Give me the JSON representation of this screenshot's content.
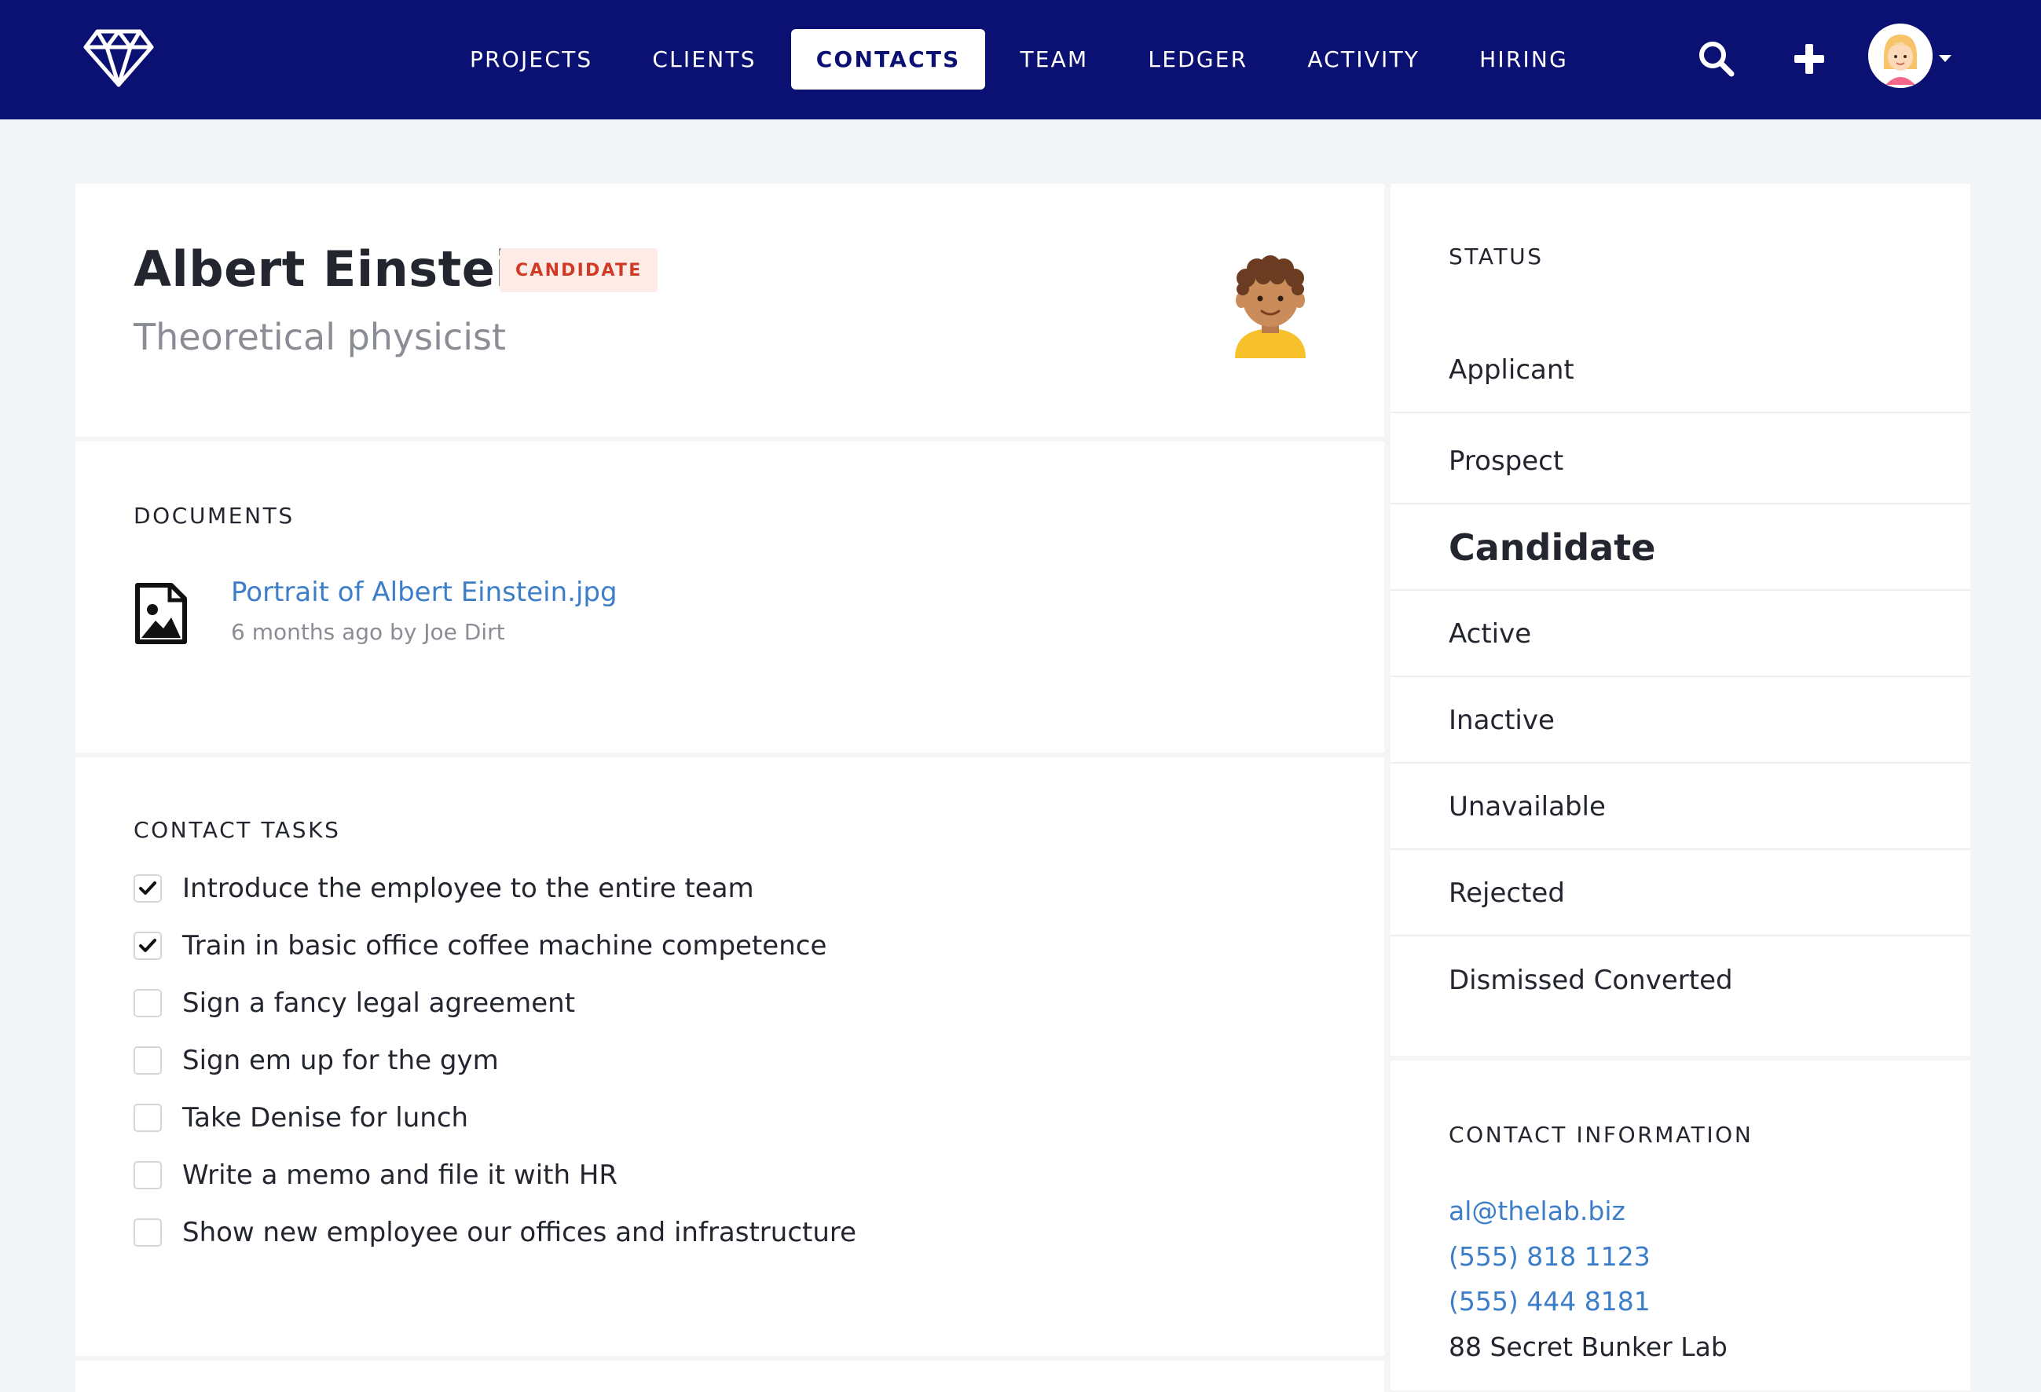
{
  "nav": {
    "items": [
      "PROJECTS",
      "CLIENTS",
      "CONTACTS",
      "TEAM",
      "LEDGER",
      "ACTIVITY",
      "HIRING"
    ],
    "active": "CONTACTS"
  },
  "colors": {
    "navbar": "#0b1172",
    "link": "#3d7ec9",
    "badge_text": "#d03b26",
    "badge_bg": "#fdebe8",
    "page_bg": "#f4f5f7"
  },
  "icons": [
    "diamond-logo-icon",
    "search-icon",
    "plus-icon",
    "user-avatar",
    "chevron-down-icon",
    "contact-avatar",
    "image-file-icon",
    "check-icon"
  ],
  "profile": {
    "name": "Albert Einstein",
    "badge": "CANDIDATE",
    "subtitle": "Theoretical physicist"
  },
  "documents": {
    "title": "DOCUMENTS",
    "items": [
      {
        "name": "Portrait of Albert Einstein.jpg",
        "meta": "6 months ago by Joe Dirt"
      }
    ]
  },
  "tasks": {
    "title": "CONTACT TASKS",
    "items": [
      {
        "label": "Introduce the employee to the entire team",
        "checked": true
      },
      {
        "label": "Train in basic office coffee machine competence",
        "checked": true
      },
      {
        "label": "Sign a fancy legal agreement",
        "checked": false
      },
      {
        "label": "Sign em up for the gym",
        "checked": false
      },
      {
        "label": "Take Denise for lunch",
        "checked": false
      },
      {
        "label": "Write a memo and file it with HR",
        "checked": false
      },
      {
        "label": "Show new employee our offices and infrastructure",
        "checked": false
      }
    ]
  },
  "status": {
    "title": "STATUS",
    "options": [
      "Applicant",
      "Prospect",
      "Candidate",
      "Active",
      "Inactive",
      "Unavailable",
      "Rejected",
      "Dismissed Converted"
    ],
    "current": "Candidate"
  },
  "contact_info": {
    "title": "CONTACT INFORMATION",
    "email": "al@thelab.biz",
    "phones": [
      "(555) 818 1123",
      "(555) 444 8181"
    ],
    "address": "88 Secret Bunker Lab"
  }
}
